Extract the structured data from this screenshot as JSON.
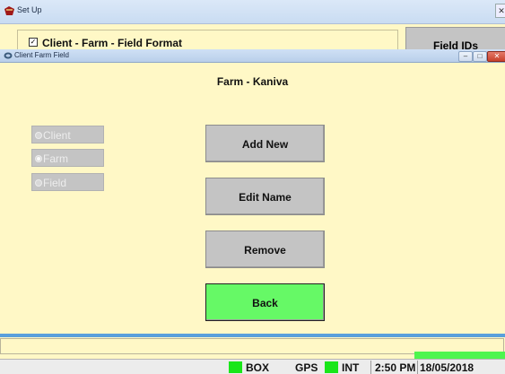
{
  "background_window": {
    "title": "Set Up",
    "close_glyph": "✕",
    "format_checkbox": {
      "checked": true,
      "mark": "✓",
      "label": "Client - Farm - Field Format"
    },
    "field_ids_button": "Field IDs"
  },
  "dialog": {
    "title": "Client Farm Field",
    "controls": {
      "minimize": "–",
      "maximize": "□",
      "close": "✕"
    },
    "heading": "Farm - Kaniva",
    "radios": [
      {
        "label": "Client",
        "selected": false
      },
      {
        "label": "Farm",
        "selected": true
      },
      {
        "label": "Field",
        "selected": false
      }
    ],
    "buttons": {
      "add_new": "Add New",
      "edit_name": "Edit Name",
      "remove": "Remove",
      "back": "Back"
    }
  },
  "status_bar": {
    "box": "BOX",
    "gps": "GPS",
    "int": "INT",
    "time": "2:50 PM",
    "date": "18/05/2018"
  },
  "colors": {
    "panel_bg": "#fff8c6",
    "button_gray": "#c4c4c4",
    "back_green": "#66f966",
    "indicator_green": "#19e619"
  }
}
